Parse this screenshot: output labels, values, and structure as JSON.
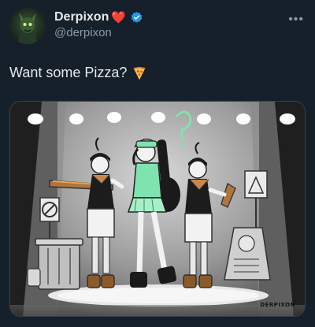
{
  "user": {
    "display_name": "Derpixon",
    "handle": "@derpixon",
    "verified": true,
    "heart_emoji": "❤️"
  },
  "tweet": {
    "text": "Want some Pizza?",
    "emoji": "pizza-icon"
  },
  "media": {
    "signature": "DERPIXON",
    "kind": "illustration"
  },
  "colors": {
    "background": "#15202b",
    "accent": "#1d9bf0",
    "heart": "#f91880",
    "muted": "#8b98a5",
    "mint": "#7fe3b0"
  }
}
